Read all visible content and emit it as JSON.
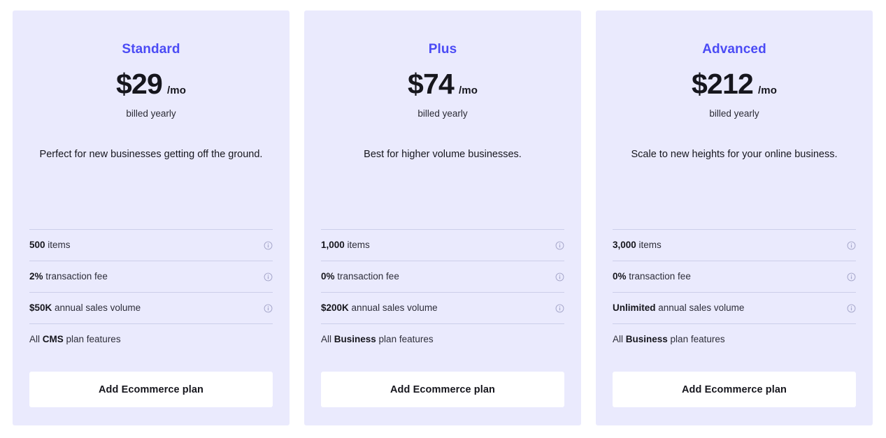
{
  "accent_color": "#4b4bf5",
  "card_background": "#eaeafd",
  "divider_color": "#ccceea",
  "button_background": "#ffffff",
  "text_color": "#16161d",
  "plans": [
    {
      "name": "Standard",
      "price": "$29",
      "period": "/mo",
      "billing": "billed yearly",
      "description": "Perfect for new businesses getting off the ground.",
      "features": [
        {
          "strong": "500",
          "rest": " items",
          "has_info": true,
          "info_icon": "info-circle-icon"
        },
        {
          "strong": "2%",
          "rest": " transaction fee",
          "has_info": true,
          "info_icon": "info-circle-icon"
        },
        {
          "strong": "$50K",
          "rest": " annual sales volume",
          "has_info": true,
          "info_icon": "info-circle-icon"
        },
        {
          "prefix": "All ",
          "strong": "CMS",
          "rest": " plan features",
          "has_info": false
        }
      ],
      "cta_label": "Add Ecommerce plan"
    },
    {
      "name": "Plus",
      "price": "$74",
      "period": "/mo",
      "billing": "billed yearly",
      "description": "Best for higher volume businesses.",
      "features": [
        {
          "strong": "1,000",
          "rest": " items",
          "has_info": true,
          "info_icon": "info-circle-icon"
        },
        {
          "strong": "0%",
          "rest": " transaction fee",
          "has_info": true,
          "info_icon": "info-circle-icon"
        },
        {
          "strong": "$200K",
          "rest": " annual sales volume",
          "has_info": true,
          "info_icon": "info-circle-icon"
        },
        {
          "prefix": "All ",
          "strong": "Business",
          "rest": " plan features",
          "has_info": false
        }
      ],
      "cta_label": "Add Ecommerce plan"
    },
    {
      "name": "Advanced",
      "price": "$212",
      "period": "/mo",
      "billing": "billed yearly",
      "description": "Scale to new heights for your online business.",
      "features": [
        {
          "strong": "3,000",
          "rest": " items",
          "has_info": true,
          "info_icon": "info-circle-icon"
        },
        {
          "strong": "0%",
          "rest": " transaction fee",
          "has_info": true,
          "info_icon": "info-circle-icon"
        },
        {
          "strong": "Unlimited",
          "rest": " annual sales volume",
          "has_info": true,
          "info_icon": "info-circle-icon"
        },
        {
          "prefix": "All ",
          "strong": "Business",
          "rest": " plan features",
          "has_info": false
        }
      ],
      "cta_label": "Add Ecommerce plan"
    }
  ]
}
